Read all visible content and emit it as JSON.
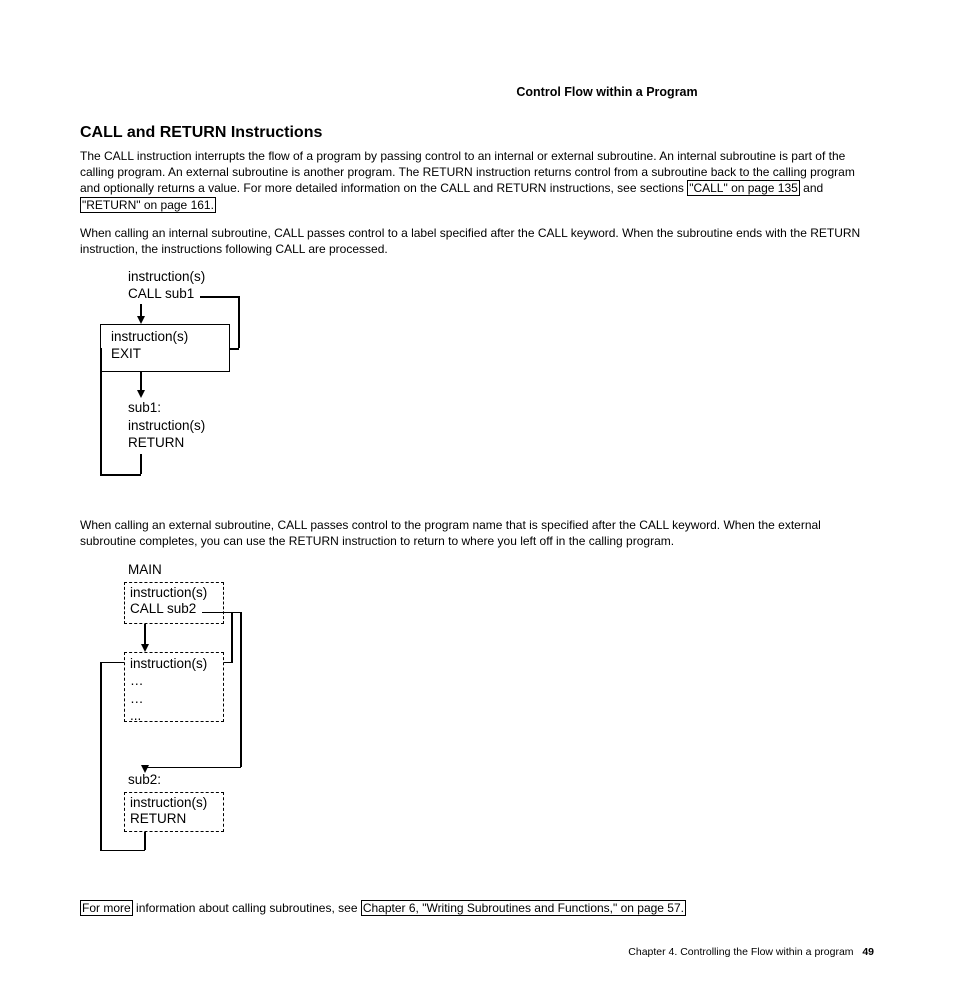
{
  "runningHead": "Control Flow within a Program",
  "sectionTitle": "CALL and RETURN Instructions",
  "para1a": "The CALL instruction interrupts the flow of a program by passing control to an internal or external subroutine. An internal subroutine is part of the calling program. An external subroutine is another program. The RETURN instruction returns control from a subroutine back to the calling program and optionally returns a value. For more detailed information on the CALL and RETURN instructions, see sections ",
  "xref1": "\"CALL\" on page 135",
  "para1b": " and ",
  "xref2": "\"RETURN\" on page 161.",
  "para2": "When calling an internal subroutine, CALL passes control to a label specified after the CALL keyword. When the subroutine ends with the RETURN instruction, the instructions following CALL are processed.",
  "d1": {
    "top1": "instruction(s)",
    "top2": "CALL sub1",
    "box1a": "instruction(s)",
    "box1b": "EXIT",
    "bot1": "sub1:",
    "bot2": "instruction(s)",
    "bot3": "RETURN"
  },
  "para3": "When calling an external subroutine, CALL passes control to the program name that is specified after the CALL keyword. When the external subroutine completes, you can use the RETURN instruction to return to where you left off in the calling program.",
  "d2": {
    "main": "MAIN",
    "b1a": "instruction(s)",
    "b1b": "CALL sub2",
    "b2a": "instruction(s)",
    "dots": "…",
    "dots2": "…",
    "dots3": "...",
    "sub2": "sub2:",
    "b3a": "instruction(s)",
    "b3b": "RETURN"
  },
  "para4a": "For more",
  "para4b": " information about calling subroutines, see ",
  "xref3": "Chapter 6, \"Writing Subroutines and Functions,\" on page 57.",
  "footerChapter": "Chapter 4. Controlling the Flow within a program",
  "footerPage": "49"
}
